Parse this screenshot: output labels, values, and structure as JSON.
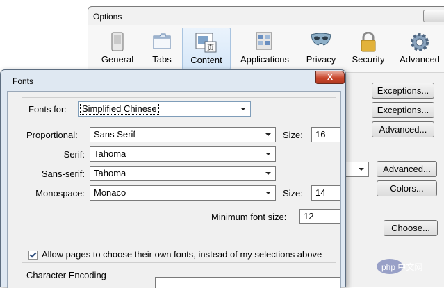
{
  "options": {
    "title": "Options",
    "tabs": [
      {
        "label": "General",
        "icon": "general-icon"
      },
      {
        "label": "Tabs",
        "icon": "tabs-icon"
      },
      {
        "label": "Content",
        "icon": "content-icon",
        "selected": true
      },
      {
        "label": "Applications",
        "icon": "applications-icon"
      },
      {
        "label": "Privacy",
        "icon": "privacy-mask-icon"
      },
      {
        "label": "Security",
        "icon": "security-lock-icon"
      },
      {
        "label": "Advanced",
        "icon": "advanced-gear-icon"
      }
    ],
    "buttons": {
      "exceptions1": "Exceptions...",
      "exceptions2": "Exceptions...",
      "advanced1": "Advanced...",
      "advanced2": "Advanced...",
      "colors": "Colors...",
      "choose": "Choose..."
    }
  },
  "fonts": {
    "title": "Fonts",
    "close_label": "X",
    "fonts_for_label": "Fonts for:",
    "fonts_for_value": "Simplified Chinese",
    "proportional_label": "Proportional:",
    "proportional_value": "Sans Serif",
    "size_label": "Size:",
    "proportional_size": "16",
    "serif_label": "Serif:",
    "serif_value": "Tahoma",
    "sans_serif_label": "Sans-serif:",
    "sans_serif_value": "Tahoma",
    "monospace_label": "Monospace:",
    "monospace_value": "Monaco",
    "monospace_size": "14",
    "min_size_label": "Minimum font size:",
    "min_size_value": "12",
    "allow_pages_label": "Allow pages to choose their own fonts, instead of my selections above",
    "allow_pages_checked": true,
    "char_encoding_label": "Character Encoding"
  },
  "watermark": {
    "text": "php 中文网",
    "logo": "php-logo"
  },
  "colors": {
    "accent": "#c9462c",
    "title_bar": "#dfe8f2",
    "selected_tab": "#d6e7f8"
  }
}
